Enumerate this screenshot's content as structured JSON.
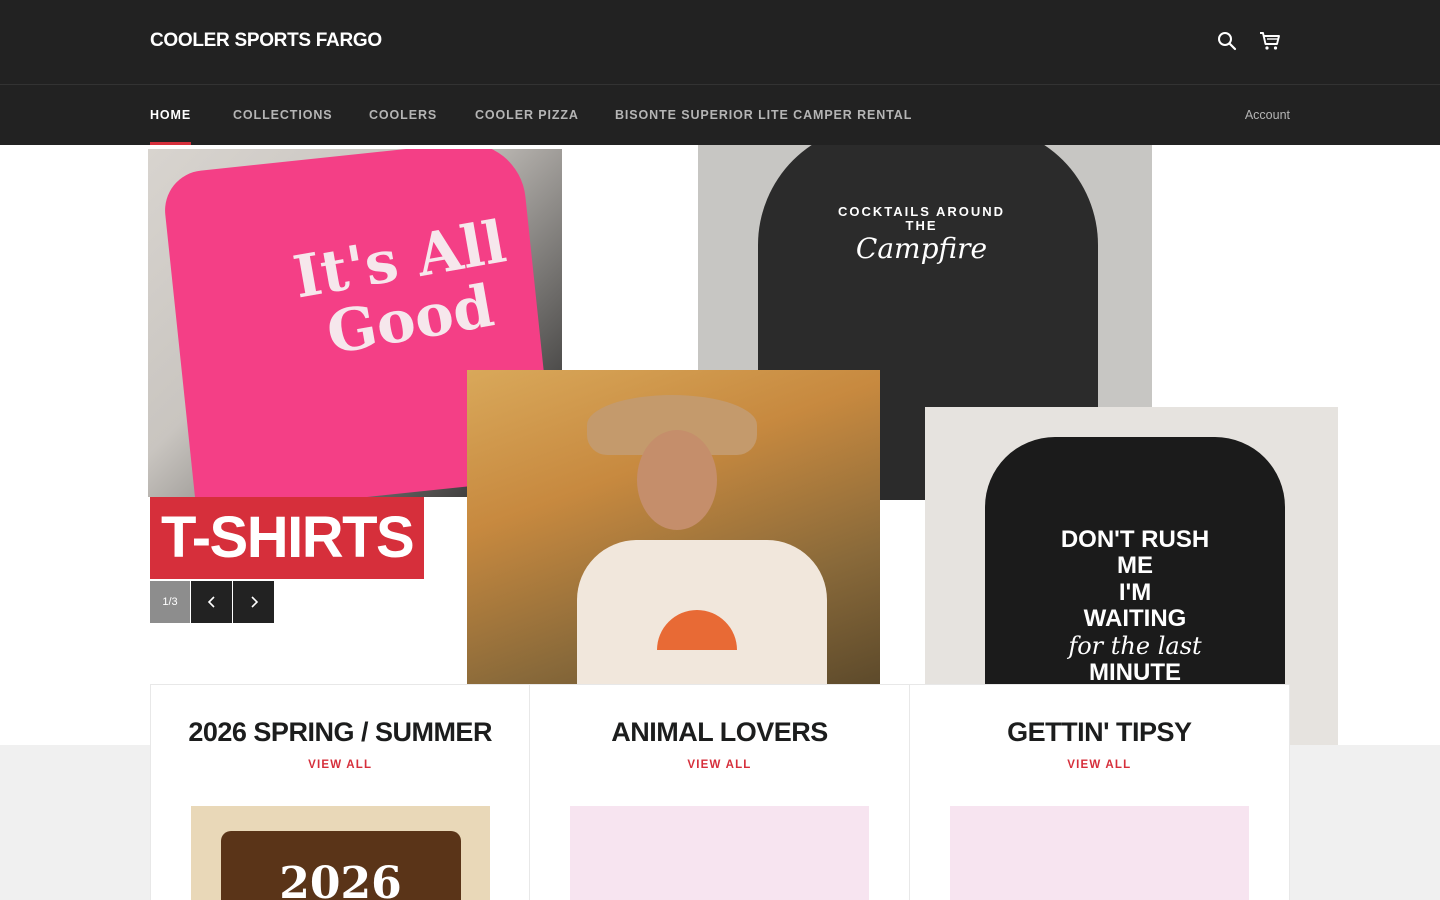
{
  "header": {
    "logo": "COOLER SPORTS FARGO",
    "search_icon": "search-icon",
    "cart_icon": "cart-icon"
  },
  "nav": {
    "items": [
      {
        "label": "HOME",
        "active": true
      },
      {
        "label": "COLLECTIONS",
        "active": false
      },
      {
        "label": "COOLERS",
        "active": false
      },
      {
        "label": "COOLER PIZZA",
        "active": false
      },
      {
        "label": "BISONTE SUPERIOR LITE CAMPER RENTAL",
        "active": false
      }
    ],
    "account": "Account"
  },
  "hero": {
    "slide_title": "T-SHIRTS",
    "counter": "1/3",
    "prev_icon": "chevron-left-icon",
    "next_icon": "chevron-right-icon",
    "photo_texts": {
      "pink_shirt": "It's All Good",
      "hoodie_top": "COCKTAILS AROUND",
      "hoodie_mid": "THE",
      "hoodie_script": "Campfire",
      "black_tee_1": "DON'T RUSH ME",
      "black_tee_2": "I'M",
      "black_tee_3": "WAITING",
      "black_tee_4": "for the last",
      "black_tee_5": "MINUTE",
      "card_year": "2026"
    }
  },
  "collections": [
    {
      "title": "2026 SPRING / SUMMER",
      "link": "VIEW ALL"
    },
    {
      "title": "ANIMAL LOVERS",
      "link": "VIEW ALL"
    },
    {
      "title": "GETTIN' TIPSY",
      "link": "VIEW ALL"
    }
  ],
  "colors": {
    "header_bg": "#222222",
    "accent": "#d62f3b",
    "section_bg": "#f0f0f0"
  }
}
